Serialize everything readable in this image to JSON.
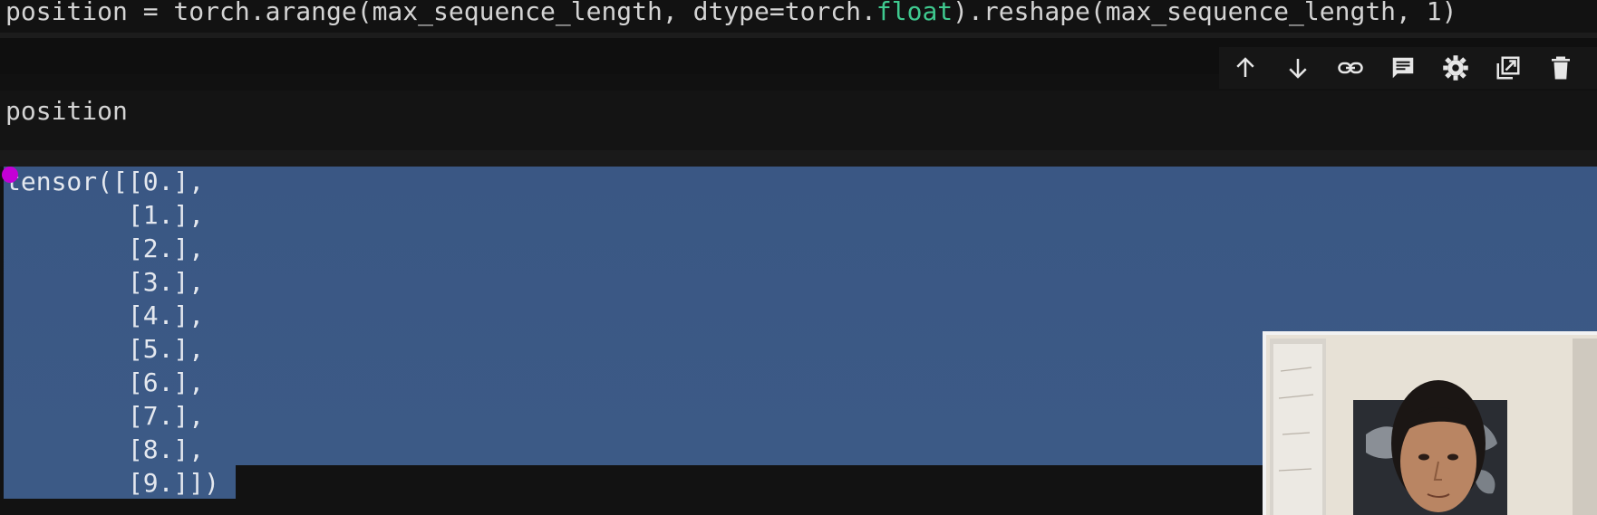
{
  "top_cell": {
    "code_before": "position = torch.arange(max_sequence_length, dtype=torch.",
    "code_keyword": "float",
    "code_after": ").reshape(max_sequence_length, 1)"
  },
  "cell_toolbar": {
    "move_up": "move-up",
    "move_down": "move-down",
    "link": "link",
    "comment": "comment",
    "settings": "settings",
    "open_in_tab": "open-in-tab",
    "delete": "delete"
  },
  "input_cell": {
    "code": "position"
  },
  "output": {
    "lines": [
      "tensor([[0.],",
      "        [1.],",
      "        [2.],",
      "        [3.],",
      "        [4.],",
      "        [5.],",
      "        [6.],",
      "        [7.],",
      "        [8.],",
      "        [9.]])"
    ]
  },
  "webcam": {
    "description": ""
  }
}
